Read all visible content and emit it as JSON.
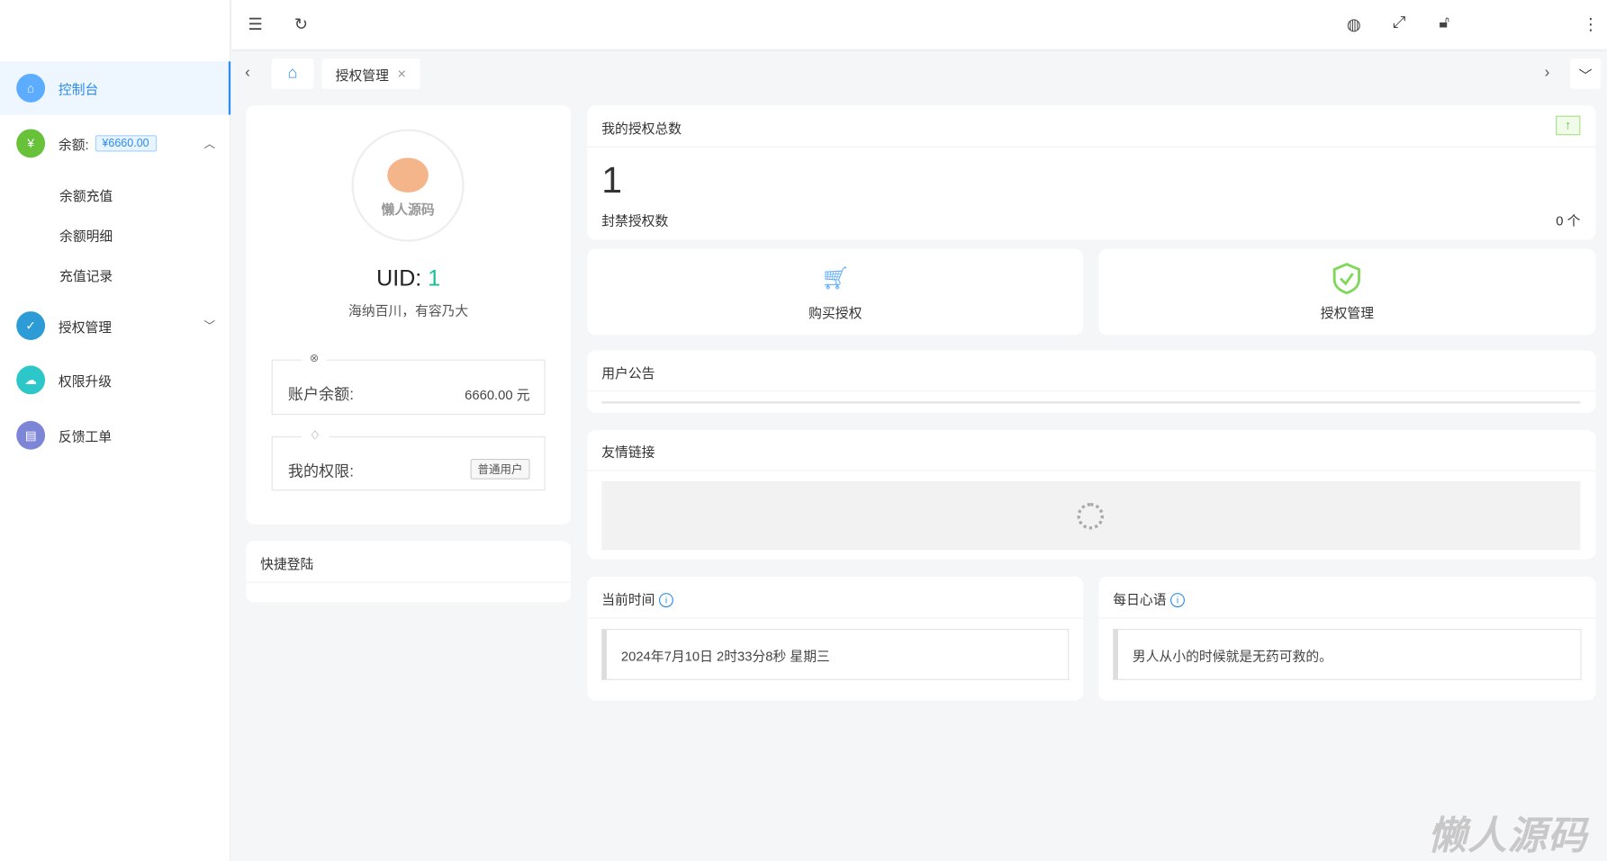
{
  "topbar": {
    "icons": [
      "menu-fold-icon",
      "refresh-icon",
      "globe-icon",
      "fullscreen-icon",
      "lock-icon",
      "more-icon"
    ]
  },
  "tabs": [
    {
      "label": "授权管理"
    }
  ],
  "sidebar": {
    "items": [
      {
        "label": "控制台",
        "color": "#5cadff"
      },
      {
        "label": "余额:",
        "badge": "¥6660.00",
        "color": "#67c23a",
        "children": [
          "余额充值",
          "余额明细",
          "充值记录"
        ]
      },
      {
        "label": "授权管理",
        "color": "#2d9bd6"
      },
      {
        "label": "权限升级",
        "color": "#2ec7c9"
      },
      {
        "label": "反馈工单",
        "color": "#7d85d6"
      }
    ]
  },
  "profile": {
    "logo_text": "懒人源码",
    "uid_label": "UID:",
    "uid": "1",
    "motto": "海纳百川，有容乃大",
    "balance_label": "账户余额:",
    "balance": "6660.00 元",
    "perm_label": "我的权限:",
    "perm": "普通用户"
  },
  "quick_login": {
    "title": "快捷登陆"
  },
  "stats": {
    "title": "我的授权总数",
    "total": "1",
    "banned_label": "封禁授权数",
    "banned": "0 个"
  },
  "actions": [
    {
      "label": "购买授权"
    },
    {
      "label": "授权管理"
    }
  ],
  "notice": {
    "title": "用户公告"
  },
  "links": {
    "title": "友情链接"
  },
  "time": {
    "title": "当前时间",
    "value": "2024年7月10日 2时33分8秒 星期三"
  },
  "daily": {
    "title": "每日心语",
    "value": "男人从小的时候就是无药可救的。"
  },
  "watermark": "懒人源码"
}
